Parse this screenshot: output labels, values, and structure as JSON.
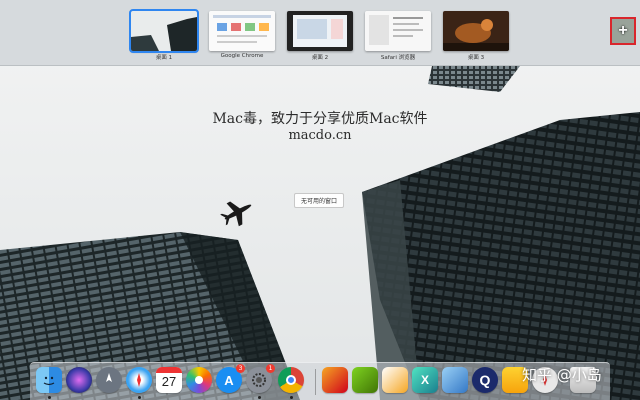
{
  "spaces": [
    {
      "label": "桌面 1",
      "active": true
    },
    {
      "label": "Google Chrome",
      "active": false
    },
    {
      "label": "桌面 2",
      "active": false
    },
    {
      "label": "Safari 浏览器",
      "active": false
    },
    {
      "label": "桌面 3",
      "active": false
    }
  ],
  "add_space": {
    "symbol": "+"
  },
  "watermark": {
    "line1": "Mac毒，致力于分享优质Mac软件",
    "line2": "macdo.cn"
  },
  "empty_notice": "无可用的窗口",
  "calendar_day": "27",
  "badges": {
    "app_store": "3",
    "system_prefs": "1"
  },
  "dock_items": [
    {
      "name": "finder-icon"
    },
    {
      "name": "siri-icon"
    },
    {
      "name": "launchpad-icon"
    },
    {
      "name": "safari-icon"
    },
    {
      "name": "calendar-icon"
    },
    {
      "name": "photos-icon"
    },
    {
      "name": "app-store-icon"
    },
    {
      "name": "system-preferences-icon"
    },
    {
      "name": "chrome-icon"
    },
    {
      "name": "paintbrush-app-icon"
    },
    {
      "name": "video-app-icon"
    },
    {
      "name": "drawing-app-icon"
    },
    {
      "name": "xcode-app-icon"
    },
    {
      "name": "preview-icon"
    },
    {
      "name": "quicktime-icon"
    },
    {
      "name": "sketch-icon"
    },
    {
      "name": "compass-app-icon"
    },
    {
      "name": "trash-icon"
    }
  ],
  "watermark_corner": "知乎 @小岛",
  "colors": {
    "active_space": "#2f86f0",
    "add_highlight": "#d9262c",
    "badge": "#ee3b30"
  }
}
